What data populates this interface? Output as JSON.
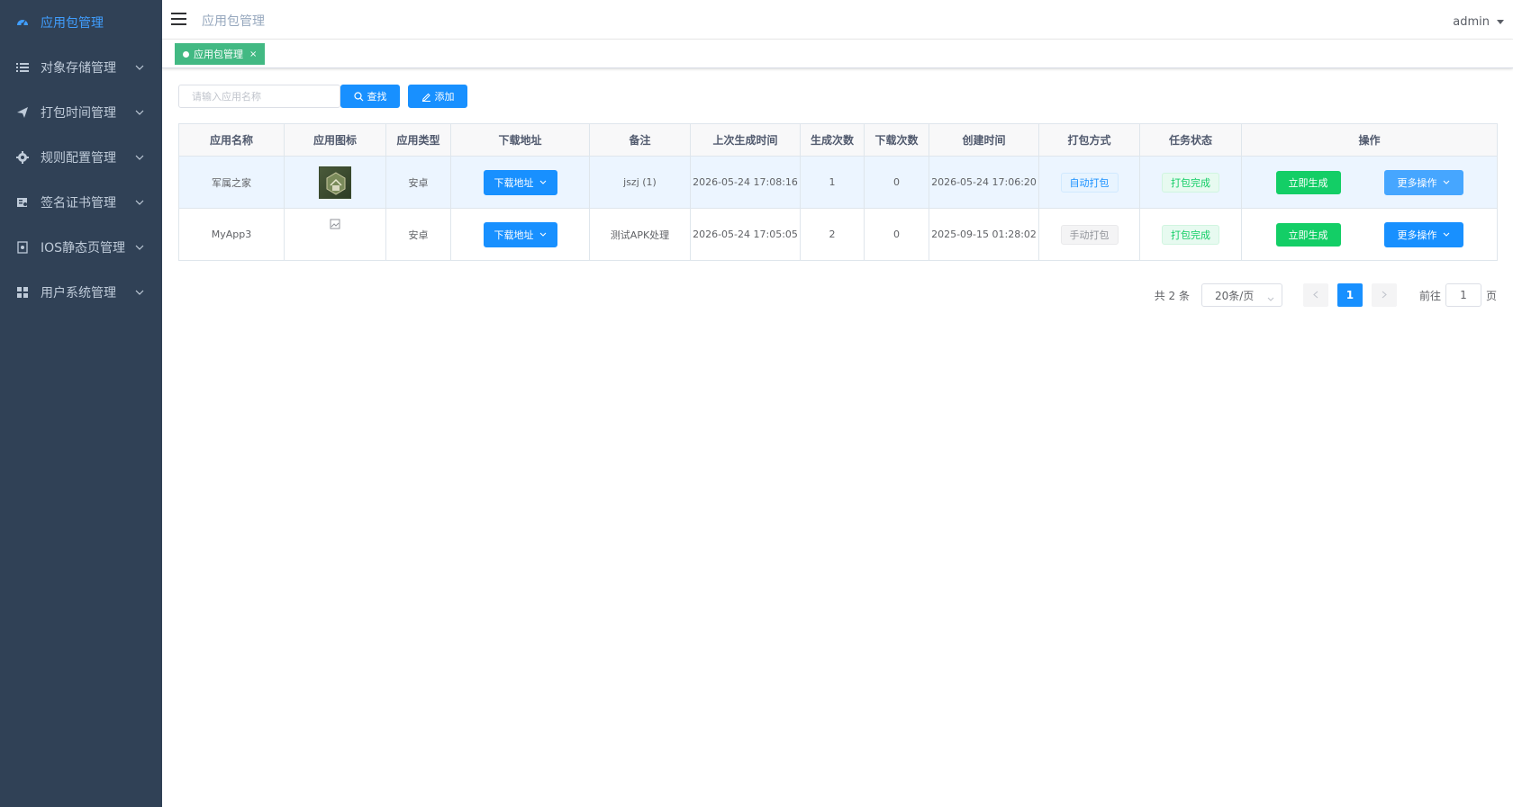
{
  "sidebar": {
    "items": [
      {
        "label": "应用包管理",
        "icon": "dashboard-icon",
        "active": true
      },
      {
        "label": "对象存储管理",
        "icon": "list-icon"
      },
      {
        "label": "打包时间管理",
        "icon": "paper-plane-icon"
      },
      {
        "label": "规则配置管理",
        "icon": "gear-icon"
      },
      {
        "label": "签名证书管理",
        "icon": "certificate-icon"
      },
      {
        "label": "IOS静态页管理",
        "icon": "page-icon"
      },
      {
        "label": "用户系统管理",
        "icon": "grid-icon"
      }
    ]
  },
  "header": {
    "breadcrumb": "应用包管理",
    "user": "admin"
  },
  "tags": {
    "active": "应用包管理",
    "close": "×"
  },
  "search": {
    "placeholder": "请输入应用名称",
    "search_label": "查找",
    "add_label": "添加"
  },
  "table": {
    "columns": [
      "应用名称",
      "应用图标",
      "应用类型",
      "下载地址",
      "备注",
      "上次生成时间",
      "生成次数",
      "下载次数",
      "创建时间",
      "打包方式",
      "任务状态",
      "操作"
    ],
    "rows": [
      {
        "name": "军属之家",
        "icon": "app-icon",
        "type": "安卓",
        "download": "下载地址",
        "note": "jszj (1)",
        "last_time": "2026-05-24 17:08:16",
        "gen_count": "1",
        "dl_count": "0",
        "created": "2026-05-24 17:06:20",
        "pack_mode": "自动打包",
        "status": "打包完成",
        "action_generate": "立即生成",
        "action_more": "更多操作"
      },
      {
        "name": "MyApp3",
        "icon": "broken-image-icon",
        "type": "安卓",
        "download": "下载地址",
        "note": "测试APK处理",
        "last_time": "2026-05-24 17:05:05",
        "gen_count": "2",
        "dl_count": "0",
        "created": "2025-09-15 01:28:02",
        "pack_mode": "手动打包",
        "status": "打包完成",
        "action_generate": "立即生成",
        "action_more": "更多操作"
      }
    ]
  },
  "pagination": {
    "total": "共 2 条",
    "page_size": "20条/页",
    "current_page": "1",
    "goto_label": "前往",
    "goto_value": "1",
    "page_suffix": "页"
  },
  "colors": {
    "sidebar_bg": "#304156",
    "sidebar_text": "#bfcbd9",
    "active": "#409eff",
    "primary": "#1890ff",
    "success": "#13ce66",
    "tag": "#42b983"
  }
}
